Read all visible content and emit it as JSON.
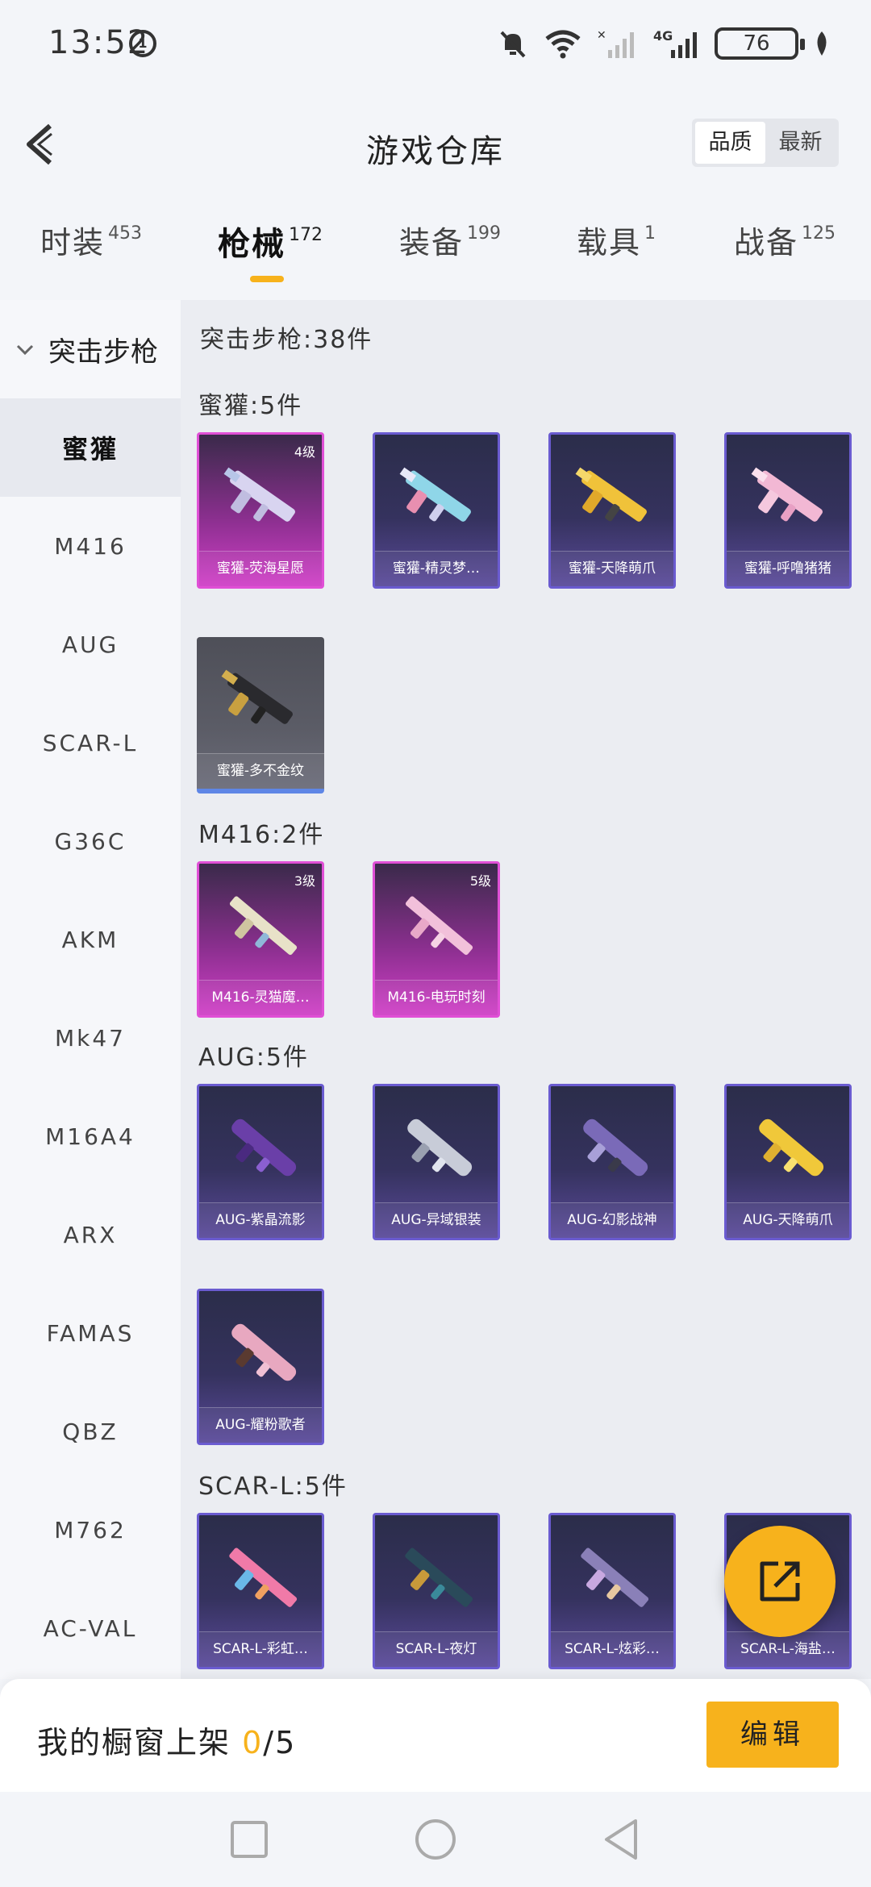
{
  "status_bar": {
    "time": "13:52",
    "network": "4G",
    "battery": "76"
  },
  "header": {
    "title": "游戏仓库",
    "sort_options": [
      "品质",
      "最新"
    ],
    "active_sort": "品质"
  },
  "tabs": [
    {
      "label": "时装",
      "count": "453"
    },
    {
      "label": "枪械",
      "count": "172",
      "active": true
    },
    {
      "label": "装备",
      "count": "199"
    },
    {
      "label": "载具",
      "count": "1"
    },
    {
      "label": "战备",
      "count": "125"
    }
  ],
  "sidebar": {
    "group": "突击步枪",
    "items": [
      "蜜獾",
      "M416",
      "AUG",
      "SCAR-L",
      "G36C",
      "AKM",
      "Mk47",
      "M16A4",
      "ARX",
      "FAMAS",
      "QBZ",
      "M762",
      "AC-VAL"
    ],
    "active_item": "蜜獾"
  },
  "content": {
    "category_title": "突击步枪:38件",
    "sections": [
      {
        "title": "蜜獾:5件",
        "items": [
          {
            "name": "蜜獾-荧海星愿",
            "level": "4级",
            "rarity": "pink"
          },
          {
            "name": "蜜獾-精灵梦…",
            "rarity": "purple"
          },
          {
            "name": "蜜獾-天降萌爪",
            "rarity": "purple"
          },
          {
            "name": "蜜獾-呼噜猪猪",
            "rarity": "purple"
          },
          {
            "name": "蜜獾-多不金纹",
            "rarity": "grey"
          }
        ]
      },
      {
        "title": "M416:2件",
        "items": [
          {
            "name": "M416-灵猫魔…",
            "level": "3级",
            "rarity": "pink"
          },
          {
            "name": "M416-电玩时刻",
            "level": "5级",
            "rarity": "pink"
          }
        ]
      },
      {
        "title": "AUG:5件",
        "items": [
          {
            "name": "AUG-紫晶流影",
            "rarity": "purple"
          },
          {
            "name": "AUG-异域银装",
            "rarity": "purple"
          },
          {
            "name": "AUG-幻影战神",
            "rarity": "purple"
          },
          {
            "name": "AUG-天降萌爪",
            "rarity": "purple"
          },
          {
            "name": "AUG-耀粉歌者",
            "rarity": "purple"
          }
        ]
      },
      {
        "title": "SCAR-L:5件",
        "items": [
          {
            "name": "SCAR-L-彩虹…",
            "rarity": "purple"
          },
          {
            "name": "SCAR-L-夜灯",
            "rarity": "purple"
          },
          {
            "name": "SCAR-L-炫彩…",
            "rarity": "purple"
          },
          {
            "name": "SCAR-L-海盐…",
            "rarity": "purple"
          }
        ]
      }
    ]
  },
  "bottom_bar": {
    "shelf_label": "我的橱窗上架 ",
    "shelf_count": "0",
    "shelf_total": "/5",
    "edit_label": "编辑"
  },
  "colors": {
    "accent": "#f7b21c",
    "pink_rarity": "#e04fd6",
    "purple_rarity": "#6a5bd0",
    "grey_rarity": "#5e86e6"
  }
}
